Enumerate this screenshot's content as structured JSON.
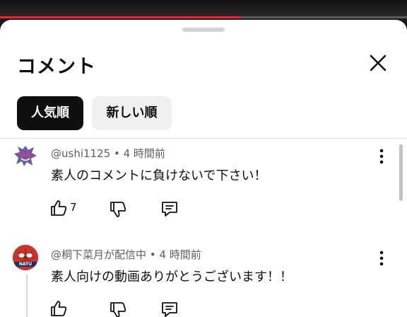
{
  "video": {
    "progress_fraction": 0.59
  },
  "sheet": {
    "title": "コメント",
    "close_icon": "close-icon"
  },
  "sort": {
    "options": [
      {
        "label": "人気順",
        "active": true
      },
      {
        "label": "新しい順",
        "active": false
      }
    ]
  },
  "comments": [
    {
      "author": "@ushi1125",
      "time": "4 時間前",
      "text": "素人のコメントに負けないで下さい！",
      "likes": "7",
      "avatar_icon": "ghost-avatar",
      "actions": [
        "thumb-up-icon",
        "thumb-down-icon",
        "reply-icon"
      ]
    },
    {
      "author": "@桐下菜月が配信中",
      "time": "4 時間前",
      "text": "素人向けの動画ありがとうございます！！",
      "likes": "",
      "avatar_icon": "mask-avatar",
      "avatar_text": "NATU",
      "actions": [
        "thumb-up-icon",
        "thumb-down-icon",
        "reply-icon"
      ]
    }
  ],
  "colors": {
    "accent": "#ff1a2e",
    "chip_active_bg": "#0f0f0f",
    "chip_inactive_bg": "#f0f0f0",
    "meta_text": "#606060"
  },
  "separator": " • "
}
